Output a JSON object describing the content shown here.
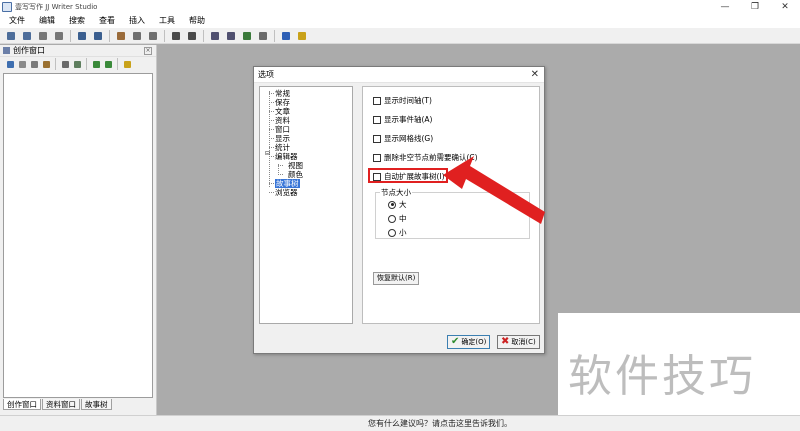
{
  "window": {
    "title": "壹写写作 JJ Writer Studio",
    "controls": [
      "—",
      "❐",
      "✕"
    ]
  },
  "menu": [
    "文件",
    "编辑",
    "搜索",
    "查看",
    "插入",
    "工具",
    "帮助"
  ],
  "toolbar": {
    "icons": [
      "save-icon",
      "save-all-icon",
      "print-icon",
      "print-preview-icon",
      "undo-icon",
      "redo-icon",
      "cut-icon",
      "copy-icon",
      "paste-icon",
      "indent-icon",
      "outdent-icon",
      "find-icon",
      "replace-icon",
      "spellcheck-icon",
      "format-icon",
      "help-icon",
      "tip-icon"
    ],
    "colors": [
      "#4d6d9a",
      "#4d6d9a",
      "#777777",
      "#777777",
      "#3b5f8f",
      "#3b5f8f",
      "#9a6b3a",
      "#6f6f6f",
      "#6f6f6f",
      "#4a4a4a",
      "#4a4a4a",
      "#505070",
      "#505070",
      "#3b7a3b",
      "#6a6a6a",
      "#2d5fb5",
      "#c9a21a"
    ]
  },
  "left_panel": {
    "title": "创作窗口",
    "close": "×",
    "tabs": [
      "创作窗口",
      "资料窗口",
      "故事树"
    ]
  },
  "dialog": {
    "title": "选项",
    "close": "✕",
    "tree": {
      "items": [
        {
          "label": "常规"
        },
        {
          "label": "保存"
        },
        {
          "label": "文章"
        },
        {
          "label": "资料"
        },
        {
          "label": "窗口"
        },
        {
          "label": "显示"
        },
        {
          "label": "统计"
        },
        {
          "label": "编辑器"
        },
        {
          "label": "视图"
        },
        {
          "label": "颜色"
        },
        {
          "label": "故事树",
          "selected": true
        },
        {
          "label": "浏览器"
        }
      ],
      "expander": "⊟"
    },
    "options": [
      {
        "label": "显示时间轴(T)",
        "checked": false
      },
      {
        "label": "显示事件轴(A)",
        "checked": false
      },
      {
        "label": "显示网格线(G)",
        "checked": false
      },
      {
        "label": "删除非空节点前需要确认(C)",
        "checked": false
      },
      {
        "label": "自动扩展故事树(I)",
        "checked": false
      }
    ],
    "node_size": {
      "title": "节点大小",
      "options": [
        {
          "label": "大",
          "selected": true
        },
        {
          "label": "中",
          "selected": false
        },
        {
          "label": "小",
          "selected": false
        }
      ]
    },
    "restore_label": "恢复默认(R)",
    "ok_label": "确定(O)",
    "cancel_label": "取消(C)"
  },
  "status": {
    "text": "您有什么建议吗？请点击这里告诉我们。"
  },
  "watermark": "软件技巧",
  "colors": {
    "highlight": "#e02020",
    "selection": "#3875d7",
    "workspace": "#ababab"
  }
}
